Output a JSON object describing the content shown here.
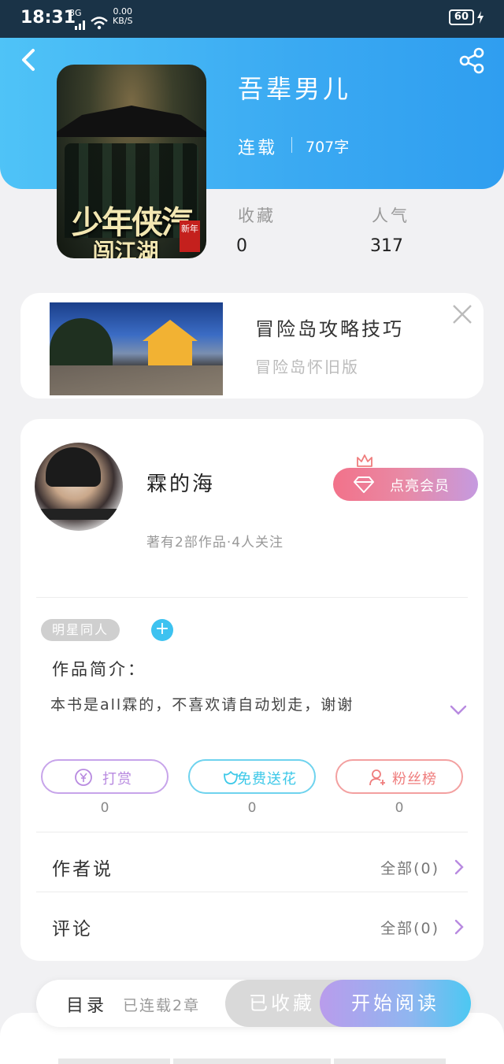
{
  "status_bar": {
    "time": "18:31",
    "network": "3G",
    "speed_value": "0.00",
    "speed_unit": "KB/S",
    "battery": "60"
  },
  "nav": {
    "back_icon": "chevron-left-icon",
    "share_icon": "share-icon"
  },
  "book": {
    "title": "吾辈男儿",
    "status": "连载",
    "word_count": "707字",
    "cover_title": "少年侠汽",
    "cover_subtitle": "闯江湖",
    "cover_badge": "新年",
    "favorites_label": "收藏",
    "favorites_value": "0",
    "popularity_label": "人气",
    "popularity_value": "317"
  },
  "ad": {
    "title": "冒险岛攻略技巧",
    "subtitle": "冒险岛怀旧版",
    "close_icon": "close-icon"
  },
  "author": {
    "name": "霖的海",
    "meta": "著有2部作品·4人关注",
    "vip_label": "点亮会员"
  },
  "tags": {
    "items": [
      "明星同人"
    ],
    "add_label": "+"
  },
  "intro": {
    "label": "作品简介：",
    "text": "本书是all霖的，不喜欢请自动划走，谢谢"
  },
  "actions": [
    {
      "label": "打赏",
      "count": "0",
      "color": "#b88ae0",
      "icon": "yuan-coin-icon"
    },
    {
      "label": "免费送花",
      "count": "0",
      "color": "#3cc8e8",
      "icon": "flower-icon"
    },
    {
      "label": "粉丝榜",
      "count": "0",
      "color": "#ef7d7d",
      "icon": "fans-user-icon"
    }
  ],
  "rows": [
    {
      "label": "作者说",
      "value": "全部(0)"
    },
    {
      "label": "评论",
      "value": "全部(0)"
    }
  ],
  "bottom_bar": {
    "toc_label": "目录",
    "toc_count": "已连载2章",
    "fav_label": "已收藏",
    "read_label": "开始阅读"
  },
  "colors": {
    "header": "#3aa9f2",
    "accent_purple": "#b88ae0",
    "accent_cyan": "#3cc8e8",
    "accent_red": "#ef7d7d"
  }
}
